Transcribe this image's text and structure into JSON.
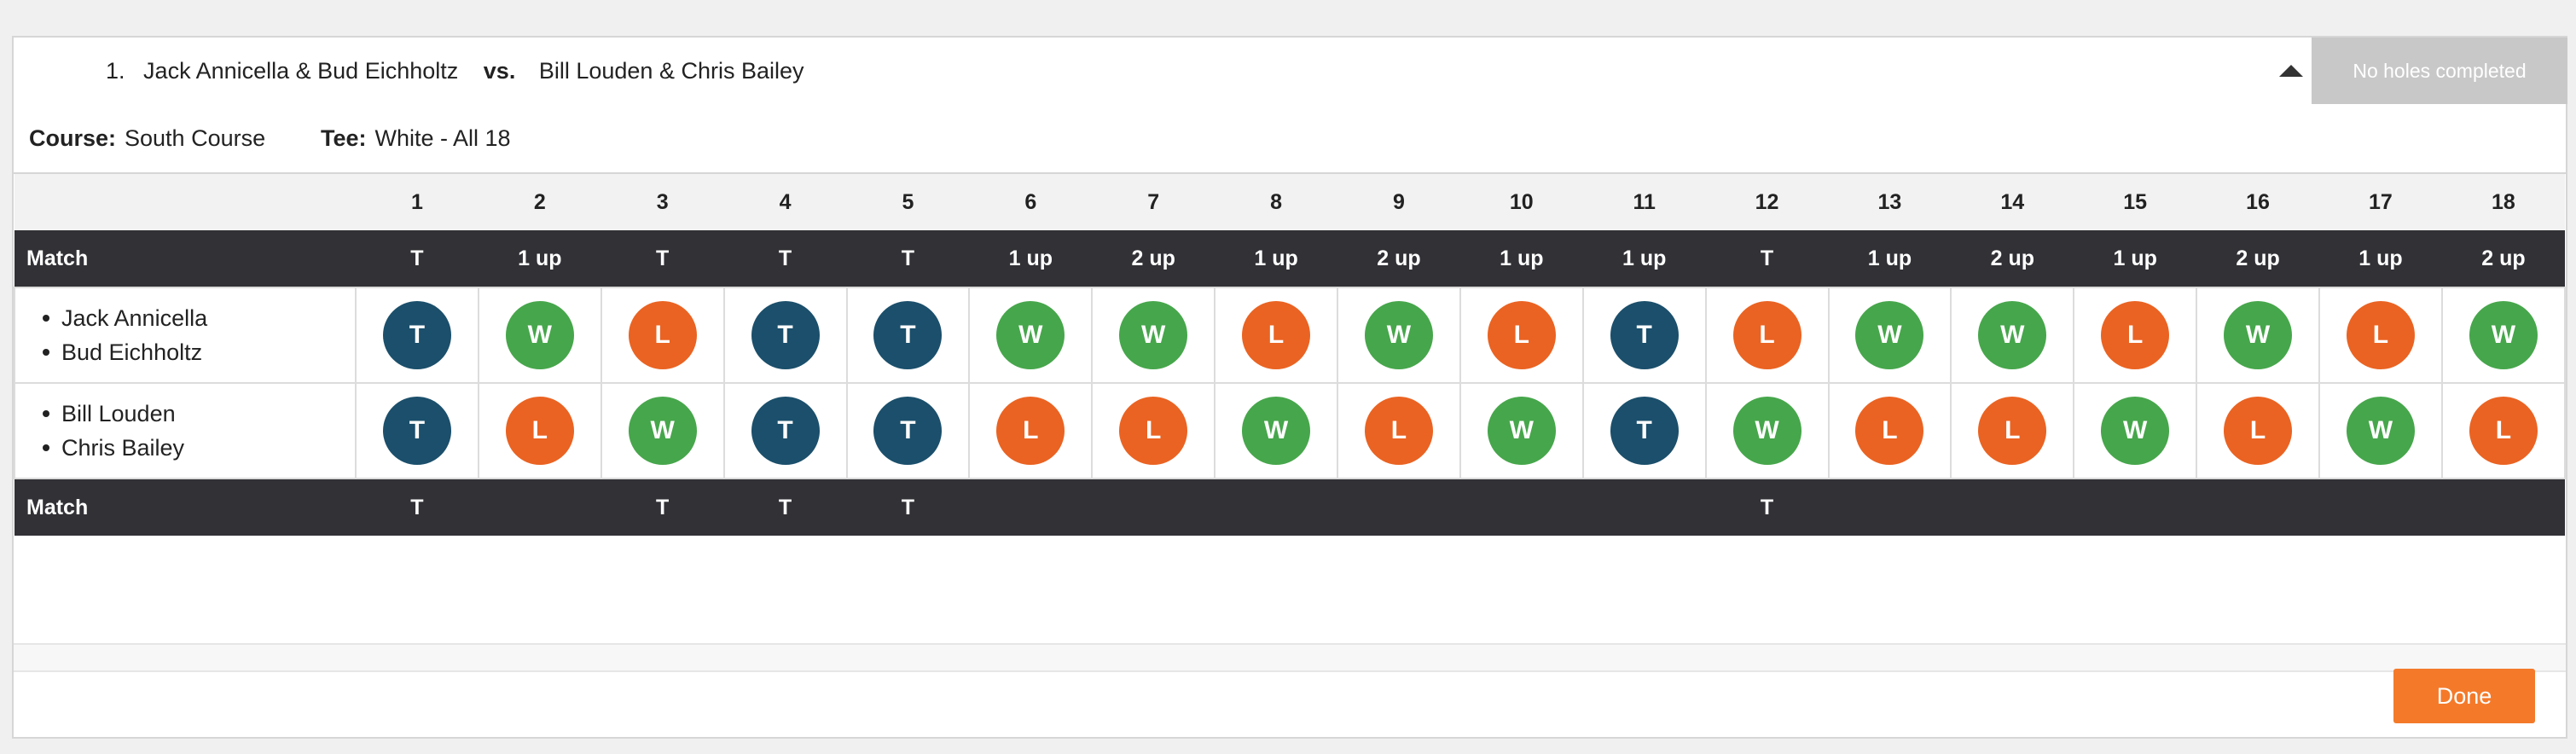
{
  "match": {
    "number": "1.",
    "team_a": "Jack Annicella & Bud Eichholtz",
    "vs": "vs.",
    "team_b": "Bill Louden & Chris Bailey",
    "status": "No holes completed"
  },
  "course": {
    "course_label": "Course:",
    "course_value": "South Course",
    "tee_label": "Tee:",
    "tee_value": "White - All 18"
  },
  "scorecard": {
    "holes": [
      "1",
      "2",
      "3",
      "4",
      "5",
      "6",
      "7",
      "8",
      "9",
      "10",
      "11",
      "12",
      "13",
      "14",
      "15",
      "16",
      "17",
      "18"
    ],
    "top_match_label": "Match",
    "top_match": [
      "T",
      "1 up",
      "T",
      "T",
      "T",
      "1 up",
      "2 up",
      "1 up",
      "2 up",
      "1 up",
      "1 up",
      "T",
      "1 up",
      "2 up",
      "1 up",
      "2 up",
      "1 up",
      "2 up"
    ],
    "teams": [
      {
        "players": [
          "Jack Annicella",
          "Bud Eichholtz"
        ],
        "results": [
          "T",
          "W",
          "L",
          "T",
          "T",
          "W",
          "W",
          "L",
          "W",
          "L",
          "T",
          "L",
          "W",
          "W",
          "L",
          "W",
          "L",
          "W"
        ]
      },
      {
        "players": [
          "Bill Louden",
          "Chris Bailey"
        ],
        "results": [
          "T",
          "L",
          "W",
          "T",
          "T",
          "L",
          "L",
          "W",
          "L",
          "W",
          "T",
          "W",
          "L",
          "L",
          "W",
          "L",
          "W",
          "L"
        ]
      }
    ],
    "bottom_match_label": "Match",
    "bottom_match": [
      "T",
      "",
      "T",
      "T",
      "T",
      "",
      "",
      "",
      "",
      "",
      "",
      "T",
      "",
      "",
      "",
      "",
      "",
      ""
    ]
  },
  "footer": {
    "done_label": "Done"
  },
  "colors": {
    "tie": "#1b4f6b",
    "win": "#46a64b",
    "loss": "#ea6322",
    "match_bar": "#313136",
    "done_button": "#f47a2a"
  }
}
